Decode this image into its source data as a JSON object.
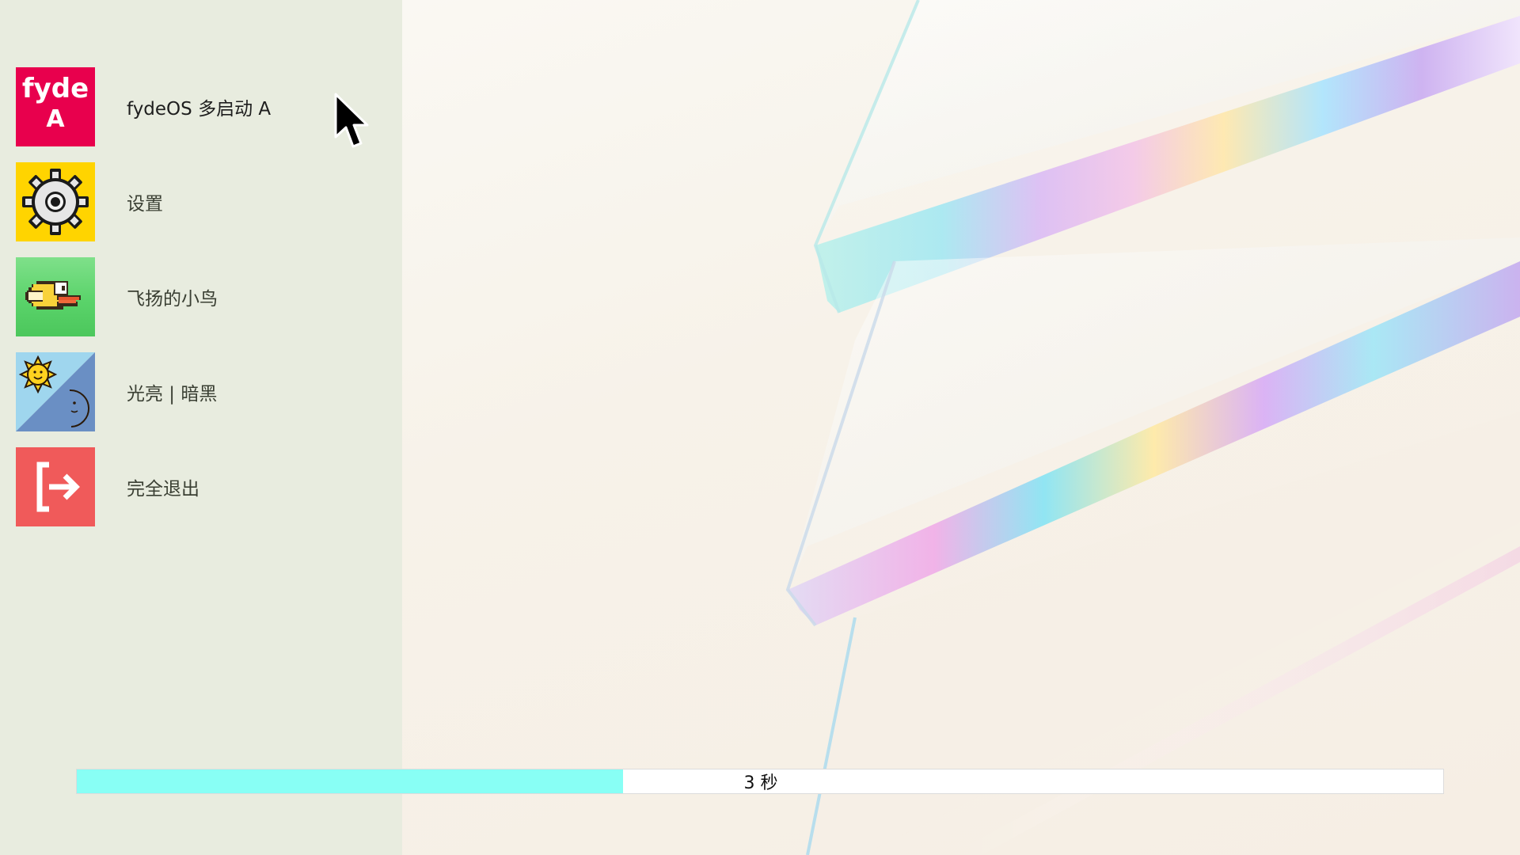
{
  "menu": {
    "items": [
      {
        "label": "fydeOS 多启动 A",
        "icon": "fyde-a-icon",
        "icon_text_1": "fyde",
        "icon_text_2": "A",
        "selected": true
      },
      {
        "label": "设置",
        "icon": "gear-icon"
      },
      {
        "label": "飞扬的小鸟",
        "icon": "flappy-bird-icon"
      },
      {
        "label": "光亮 | 暗黑",
        "icon": "sun-moon-icon"
      },
      {
        "label": "完全退出",
        "icon": "exit-icon"
      }
    ]
  },
  "countdown": {
    "text": "3 秒",
    "progress_fraction": 0.4
  },
  "colors": {
    "panel_bg": "#e8ecdf",
    "fyde_red": "#e8004d",
    "gear_yellow": "#ffd400",
    "bird_green": "#5ad36a",
    "exit_red": "#f05a5a",
    "progress_cyan": "#88fff5"
  }
}
